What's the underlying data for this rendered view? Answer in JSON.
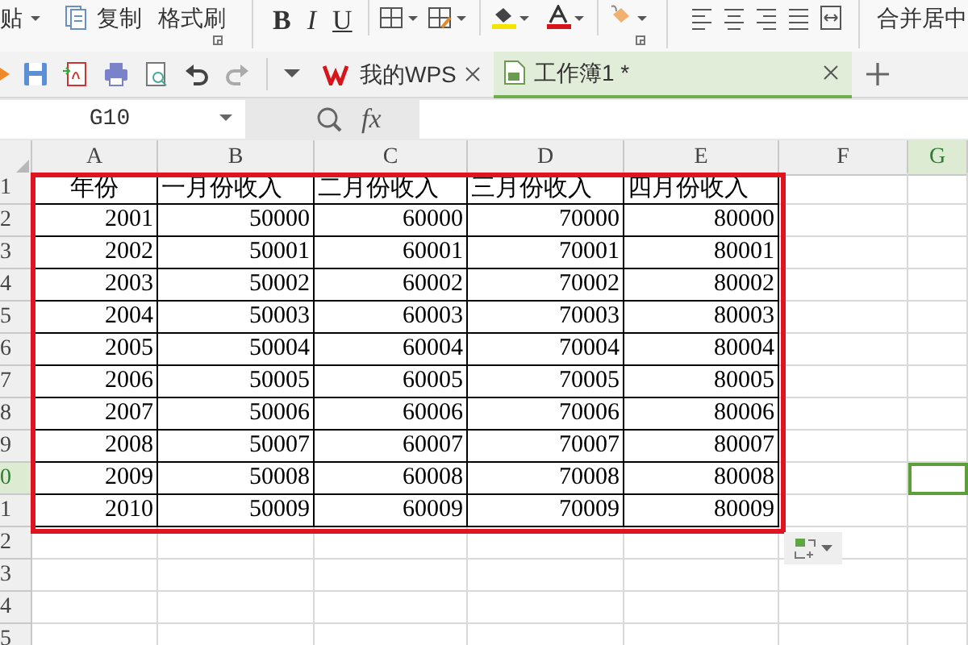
{
  "ribbon": {
    "paste_label": "贴",
    "copy_label": "复制",
    "format_painter_label": "格式刷",
    "bold": "B",
    "italic": "I",
    "underline": "U",
    "merge_label": "合并居中"
  },
  "tabs": [
    {
      "kind": "wps",
      "label": "我的WPS",
      "selected": false
    },
    {
      "kind": "workbook",
      "label": "工作簿1 *",
      "selected": true
    }
  ],
  "formula_bar": {
    "name_box": "G10",
    "function_label": "fx"
  },
  "columns": [
    {
      "label": "A",
      "selected": false
    },
    {
      "label": "B",
      "selected": false
    },
    {
      "label": "C",
      "selected": false
    },
    {
      "label": "D",
      "selected": false
    },
    {
      "label": "E",
      "selected": false
    },
    {
      "label": "F",
      "selected": false
    },
    {
      "label": "G",
      "selected": true
    }
  ],
  "rows": [
    {
      "number": "1",
      "selected": false,
      "cells": [
        "年份",
        "一月份收入",
        "二月份收入",
        "三月份收入",
        "四月份收入"
      ]
    },
    {
      "number": "2",
      "selected": false,
      "cells": [
        "2001",
        "50000",
        "60000",
        "70000",
        "80000"
      ]
    },
    {
      "number": "3",
      "selected": false,
      "cells": [
        "2002",
        "50001",
        "60001",
        "70001",
        "80001"
      ]
    },
    {
      "number": "4",
      "selected": false,
      "cells": [
        "2003",
        "50002",
        "60002",
        "70002",
        "80002"
      ]
    },
    {
      "number": "5",
      "selected": false,
      "cells": [
        "2004",
        "50003",
        "60003",
        "70003",
        "80003"
      ]
    },
    {
      "number": "6",
      "selected": false,
      "cells": [
        "2005",
        "50004",
        "60004",
        "70004",
        "80004"
      ]
    },
    {
      "number": "7",
      "selected": false,
      "cells": [
        "2006",
        "50005",
        "60005",
        "70005",
        "80005"
      ]
    },
    {
      "number": "8",
      "selected": false,
      "cells": [
        "2007",
        "50006",
        "60006",
        "70006",
        "80006"
      ]
    },
    {
      "number": "9",
      "selected": false,
      "cells": [
        "2008",
        "50007",
        "60007",
        "70007",
        "80007"
      ]
    },
    {
      "number": "0",
      "selected": true,
      "cells": [
        "2009",
        "50008",
        "60008",
        "70008",
        "80008"
      ]
    },
    {
      "number": "1",
      "selected": false,
      "cells": [
        "2010",
        "50009",
        "60009",
        "70009",
        "80009"
      ]
    },
    {
      "number": "2",
      "selected": false
    },
    {
      "number": "3",
      "selected": false
    },
    {
      "number": "4",
      "selected": false
    },
    {
      "number": "5",
      "selected": false
    }
  ]
}
